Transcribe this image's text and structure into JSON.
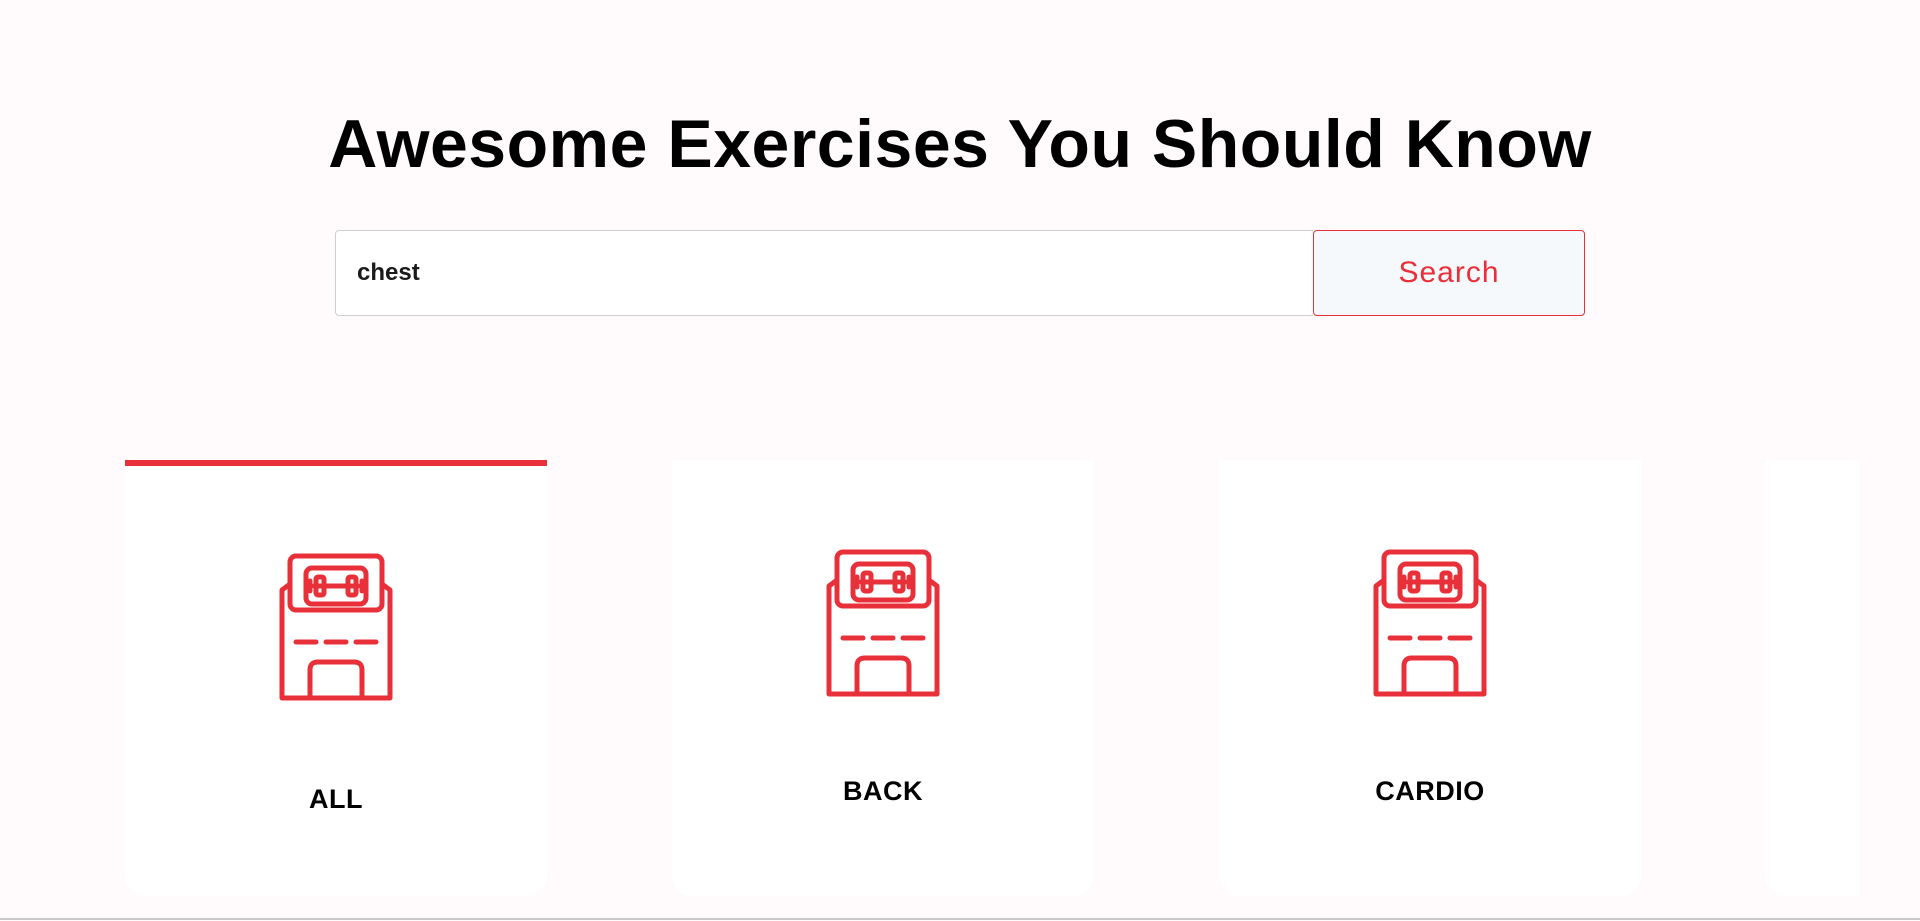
{
  "header": {
    "title": "Awesome Exercises You Should Know"
  },
  "search": {
    "value": "chest",
    "button_label": "Search"
  },
  "categories": [
    {
      "label": "ALL",
      "icon": "gym-icon",
      "selected": true
    },
    {
      "label": "BACK",
      "icon": "gym-icon",
      "selected": false
    },
    {
      "label": "CARDIO",
      "icon": "gym-icon",
      "selected": false
    }
  ],
  "colors": {
    "accent": "#e8303a",
    "background": "#fffbfc",
    "card": "#ffffff"
  }
}
